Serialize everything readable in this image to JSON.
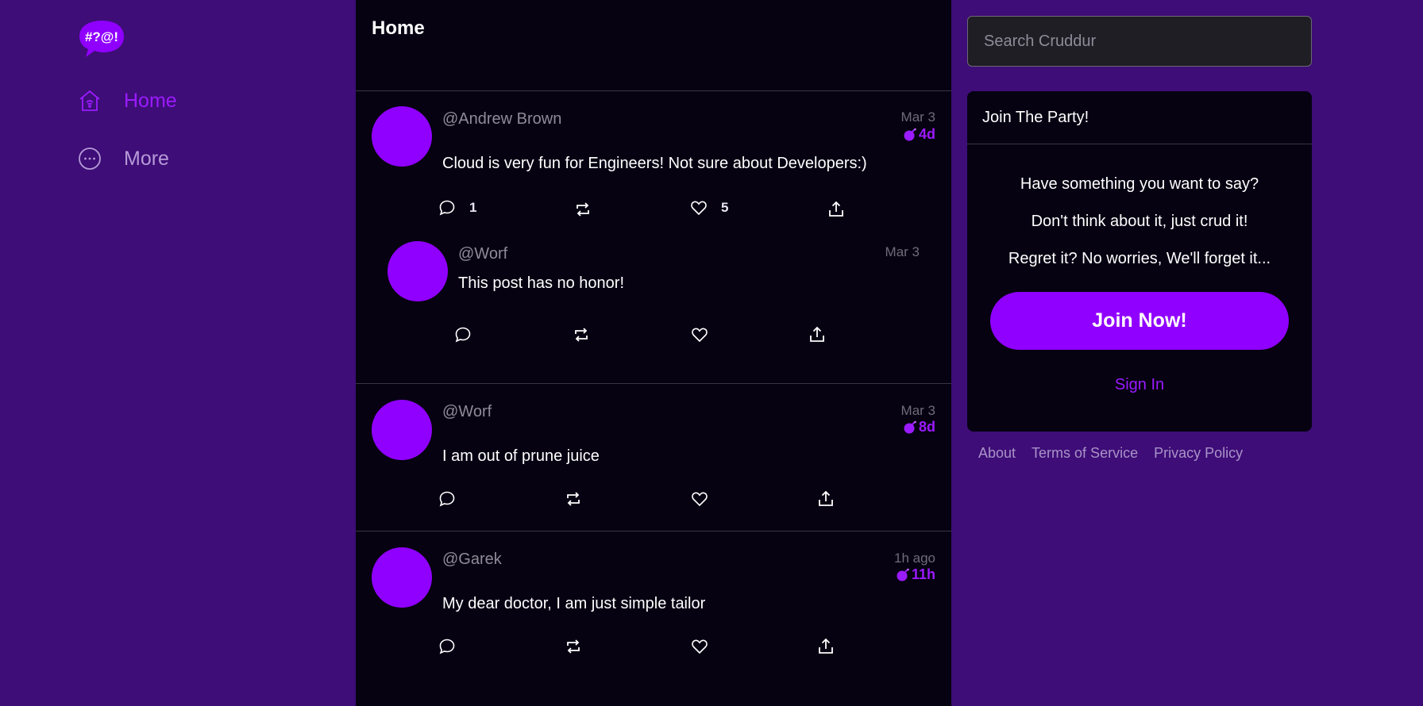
{
  "app": {
    "logo_text": "#?@!",
    "brand_color": "#9000ff",
    "background_color": "#3e0d77",
    "feed_background": "#060212"
  },
  "nav": {
    "items": [
      {
        "label": "Home",
        "icon": "home-icon",
        "active": true
      },
      {
        "label": "More",
        "icon": "more-icon",
        "active": false
      }
    ]
  },
  "feed": {
    "title": "Home",
    "posts": [
      {
        "handle": "@Andrew Brown",
        "date": "Mar 3",
        "expiry": "4d",
        "text": "Cloud is very fun for Engineers! Not sure about Developers:)",
        "replies": "1",
        "likes": "5",
        "reply": {
          "handle": "@Worf",
          "date": "Mar 3",
          "text": "This post has no honor!"
        }
      },
      {
        "handle": "@Worf",
        "date": "Mar 3",
        "expiry": "8d",
        "text": "I am out of prune juice"
      },
      {
        "handle": "@Garek",
        "date": "1h ago",
        "expiry": "11h",
        "text": "My dear doctor, I am just simple tailor"
      }
    ]
  },
  "search": {
    "placeholder": "Search Cruddur"
  },
  "join_panel": {
    "title": "Join The Party!",
    "lines": [
      "Have something you want to say?",
      "Don't think about it, just crud it!",
      "Regret it? No worries, We'll forget it..."
    ],
    "button_label": "Join Now!",
    "sign_in_label": "Sign In"
  },
  "footer": {
    "links": [
      "About",
      "Terms of Service",
      "Privacy Policy"
    ]
  }
}
